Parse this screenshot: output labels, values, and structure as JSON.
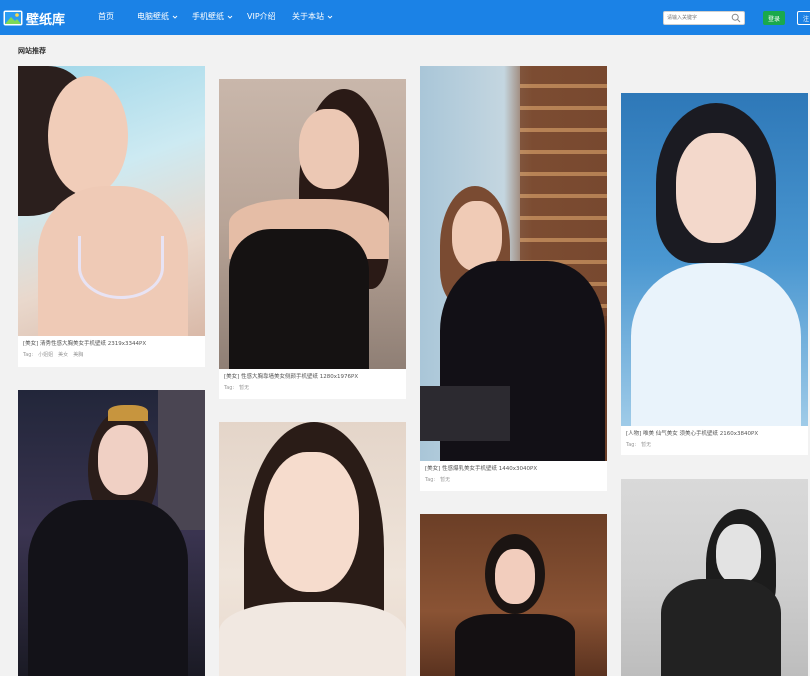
{
  "header": {
    "logo_text": "壁纸库",
    "nav": [
      {
        "label": "首页",
        "dropdown": false
      },
      {
        "label": "电脑壁纸",
        "dropdown": true
      },
      {
        "label": "手机壁纸",
        "dropdown": true
      },
      {
        "label": "VIP介绍",
        "dropdown": false
      },
      {
        "label": "关于本站",
        "dropdown": true
      }
    ],
    "search": {
      "placeholder": "请输入关键字"
    },
    "login_label": "登录",
    "register_label": "注"
  },
  "section_title": "网站推荐",
  "cards": [
    {
      "caption": "[美女] 清秀性感大胸美女手机壁纸  2319x3344PX",
      "tag_label": "Tag:",
      "tags": [
        "小姐姐",
        "美女",
        "美胸"
      ]
    },
    {
      "caption": "[美女] 性感大胸靠墙美女侧颜手机壁纸  1280x1976PX",
      "tag_label": "Tag:",
      "tags": [
        "暂无"
      ]
    },
    {
      "caption": "[美女] 性感爆乳美女手机壁纸  1440x3040PX",
      "tag_label": "Tag:",
      "tags": [
        "暂无"
      ]
    },
    {
      "caption": "[人物] 唯美 仙气美女 须美心手机壁纸  2160x3840PX",
      "tag_label": "Tag:",
      "tags": [
        "暂无"
      ]
    },
    {
      "caption": "",
      "tag_label": "",
      "tags": []
    },
    {
      "caption": "",
      "tag_label": "",
      "tags": []
    },
    {
      "caption": "",
      "tag_label": "",
      "tags": []
    },
    {
      "caption": "",
      "tag_label": "",
      "tags": []
    }
  ],
  "colors": {
    "nav_bg": "#1b82e6",
    "login_bg": "#1aa94c",
    "page_bg": "#f2f2f2"
  }
}
